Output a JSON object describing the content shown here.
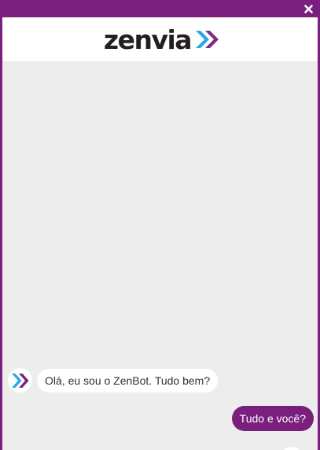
{
  "header": {
    "logo_text": "zenvia"
  },
  "window": {
    "close_icon": "close-icon"
  },
  "colors": {
    "brand_purple": "#7a1f7d",
    "arrow_blue": "#29a9e1",
    "arrow_purple": "#7a1f7d",
    "chat_background": "#ededed"
  },
  "messages": [
    {
      "sender": "bot",
      "text": "Olá, eu sou o ZenBot. Tudo bem?"
    },
    {
      "sender": "user",
      "text": "Tudo e você?"
    }
  ]
}
